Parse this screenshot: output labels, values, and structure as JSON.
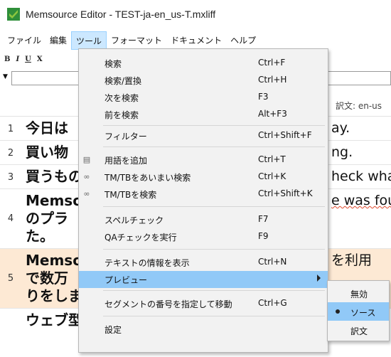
{
  "window": {
    "title": "Memsource Editor - TEST-ja-en_us-T.mxliff"
  },
  "menubar": {
    "items": [
      "ファイル",
      "編集",
      "ツール",
      "フォーマット",
      "ドキュメント",
      "ヘルプ"
    ]
  },
  "toolbar": {
    "bold": "B",
    "italic": "I",
    "underline": "U",
    "clear_format": "X"
  },
  "grid": {
    "header": {
      "target_column": "訳文: en-us"
    },
    "rows": [
      {
        "num": "1",
        "source": [
          "今日は"
        ],
        "target": [
          "ay."
        ]
      },
      {
        "num": "2",
        "source": [
          "買い物"
        ],
        "target": [
          "ng."
        ]
      },
      {
        "num": "3",
        "source": [
          "買うもの"
        ],
        "target": [
          "heck wha"
        ]
      },
      {
        "num": "4",
        "source": [
          "Memso",
          "のプラ",
          "た。"
        ],
        "target": [
          "e was fou",
          "",
          ""
        ]
      },
      {
        "num": "5",
        "source": [
          "Memso",
          "で数万",
          "りをしま"
        ],
        "target": [
          "を利用",
          "",
          ""
        ]
      },
      {
        "num": "",
        "source": [
          "ウェブ型に代わるデスクトップ"
        ],
        "target": [
          ""
        ]
      }
    ]
  },
  "tools_menu": {
    "items": [
      {
        "label": "検索",
        "shortcut": "Ctrl+F",
        "icon": ""
      },
      {
        "label": "検索/置換",
        "shortcut": "Ctrl+H",
        "icon": ""
      },
      {
        "label": "次を検索",
        "shortcut": "F3",
        "icon": ""
      },
      {
        "label": "前を検索",
        "shortcut": "Alt+F3",
        "icon": ""
      },
      {
        "label": "フィルター",
        "shortcut": "Ctrl+Shift+F",
        "icon": ""
      },
      {
        "label": "用語を追加",
        "shortcut": "Ctrl+T",
        "icon": "add-term-icon"
      },
      {
        "label": "TM/TBをあいまい検索",
        "shortcut": "Ctrl+K",
        "icon": "binoculars-icon"
      },
      {
        "label": "TM/TBを検索",
        "shortcut": "Ctrl+Shift+K",
        "icon": "binoculars-icon"
      },
      {
        "label": "スペルチェック",
        "shortcut": "F7",
        "icon": ""
      },
      {
        "label": "QAチェックを実行",
        "shortcut": "F9",
        "icon": ""
      },
      {
        "label": "テキストの情報を表示",
        "shortcut": "Ctrl+N",
        "icon": ""
      },
      {
        "label": "プレビュー",
        "shortcut": "",
        "icon": ""
      },
      {
        "label": "セグメントの番号を指定して移動",
        "shortcut": "Ctrl+G",
        "icon": ""
      },
      {
        "label": "設定",
        "shortcut": "",
        "icon": ""
      }
    ]
  },
  "preview_submenu": {
    "items": [
      "無効",
      "ソース",
      "訳文"
    ],
    "selected": "ソース"
  }
}
